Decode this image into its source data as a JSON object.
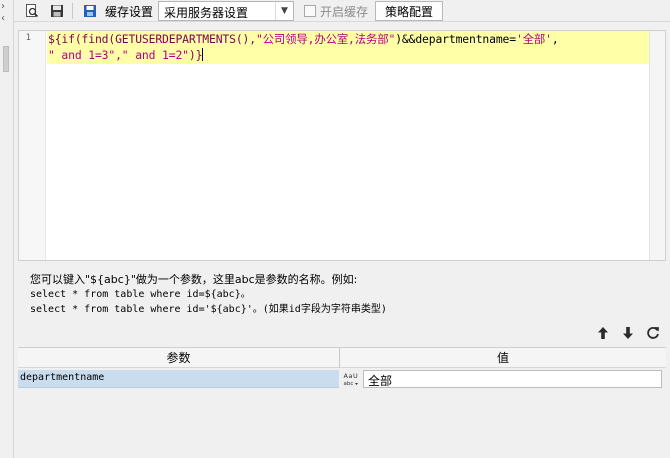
{
  "toolbar": {
    "cache_setting_label": "缓存设置",
    "cache_select_value": "采用服务器设置",
    "enable_cache_label": "开启缓存",
    "enable_cache_checked": false,
    "strategy_button_label": "策略配置",
    "icons": [
      "preview-icon",
      "save-icon",
      "cache-setting-icon"
    ]
  },
  "editor": {
    "line_number": "1",
    "code_line_1": {
      "kw": "${if(find(GETUSERDEPARTMENTS(),",
      "str": "\"公司领导,办公室,法务部\"",
      "mid": ")&&departmentname=",
      "str2": "'全部'",
      "end": ","
    },
    "code_line_2": {
      "str": "\" and 1=3\",\" and 1=2\"",
      "end": ")}"
    }
  },
  "help": {
    "line1": "您可以键入\"${abc}\"做为一个参数，这里abc是参数的名称。例如:",
    "line2": "select * from table where id=${abc}。",
    "line3": "select * from table where id='${abc}'。(如果id字段为字符串类型)"
  },
  "params": {
    "header_param": "参数",
    "header_value": "值",
    "rows": [
      {
        "name": "departmentname",
        "type_icon": "text-type-icon",
        "value": "全部"
      }
    ],
    "actions": [
      "move-up-icon",
      "move-down-icon",
      "refresh-icon"
    ]
  }
}
